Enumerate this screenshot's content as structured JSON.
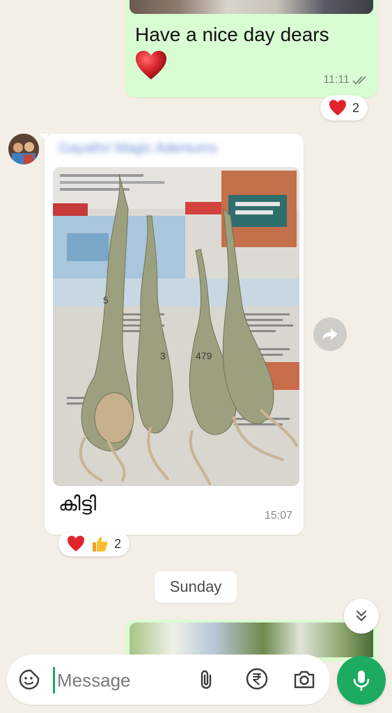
{
  "colors": {
    "chat_background": "#f3efe6",
    "outgoing_bubble": "#d9fdd3",
    "incoming_bubble": "#ffffff",
    "accent_green": "#1daa61",
    "heart_red": "#d9252c"
  },
  "outgoing_message": {
    "text": "Have a nice day dears",
    "emoji": "heart",
    "time": "11:11",
    "status_icon": "double-check-icon",
    "reactions": {
      "emojis": [
        "❤️"
      ],
      "count": "2"
    }
  },
  "incoming_message": {
    "sender_name": "Gayathri Magic Adeniums",
    "photo_icon": "adenium-roots-photo",
    "caption": "കിട്ടി",
    "time": "15:07",
    "reactions": {
      "emojis": [
        "❤️",
        "👍"
      ],
      "count": "2"
    }
  },
  "date_divider": "Sunday",
  "composer": {
    "placeholder": "Message",
    "icons": [
      "sticker-icon",
      "paperclip-icon",
      "rupee-icon",
      "camera-icon",
      "mic-icon"
    ]
  },
  "floating_buttons": [
    "forward-icon",
    "chevron-double-down-icon"
  ]
}
